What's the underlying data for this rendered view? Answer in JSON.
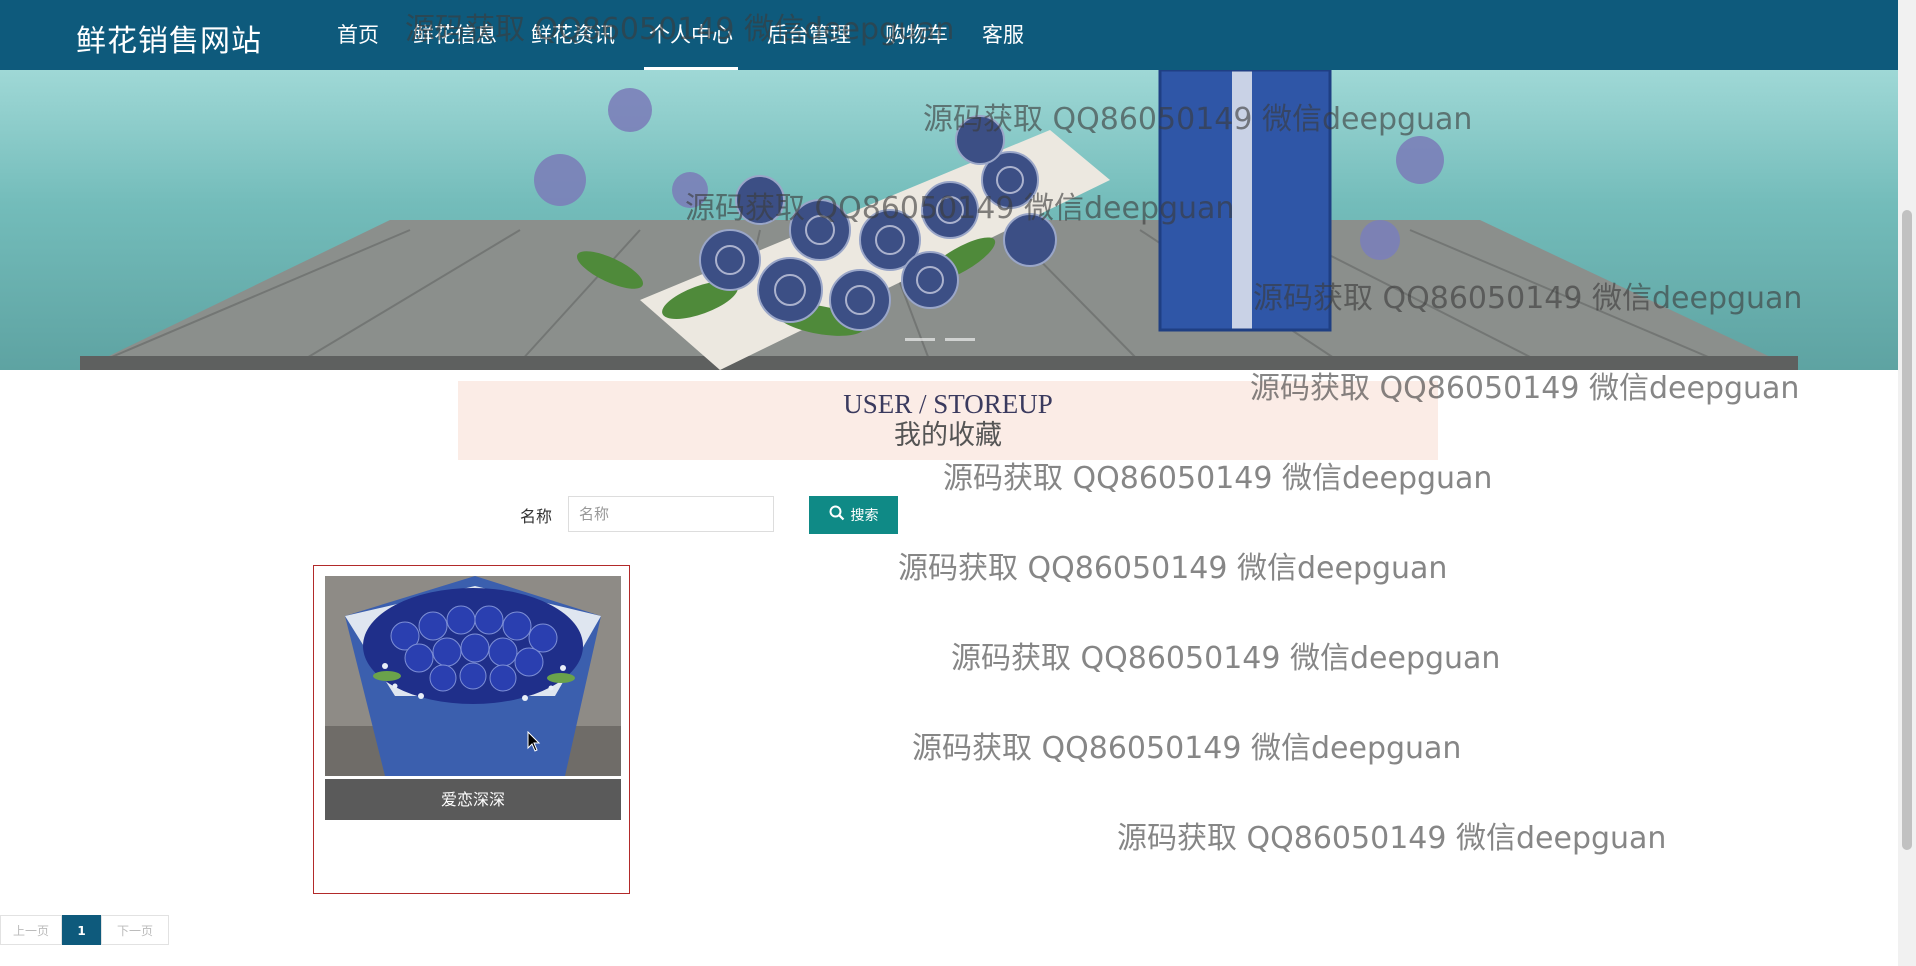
{
  "navbar": {
    "brand": "鲜花销售网站",
    "items": [
      {
        "label": "首页",
        "active": false
      },
      {
        "label": "鲜花信息",
        "active": false
      },
      {
        "label": "鲜花资讯",
        "active": false
      },
      {
        "label": "个人中心",
        "active": true
      },
      {
        "label": "后台管理",
        "active": false
      },
      {
        "label": "购物车",
        "active": false
      },
      {
        "label": "客服",
        "active": false
      }
    ]
  },
  "title": {
    "en": "USER / STOREUP",
    "cn": "我的收藏"
  },
  "search": {
    "label": "名称",
    "placeholder": "名称",
    "button_label": "搜索"
  },
  "items": [
    {
      "name": "爱恋深深",
      "image": "blue-rose-bouquet"
    }
  ],
  "pagination": {
    "prev": "上一页",
    "current": "1",
    "next": "下一页"
  },
  "watermark": {
    "text": "源码获取 QQ86050149 微信deepguan"
  },
  "colors": {
    "navbar": "#0e5a7c",
    "search_button": "#0f8a86",
    "title_bg": "#fbece6",
    "card_border": "#b22a2a"
  }
}
